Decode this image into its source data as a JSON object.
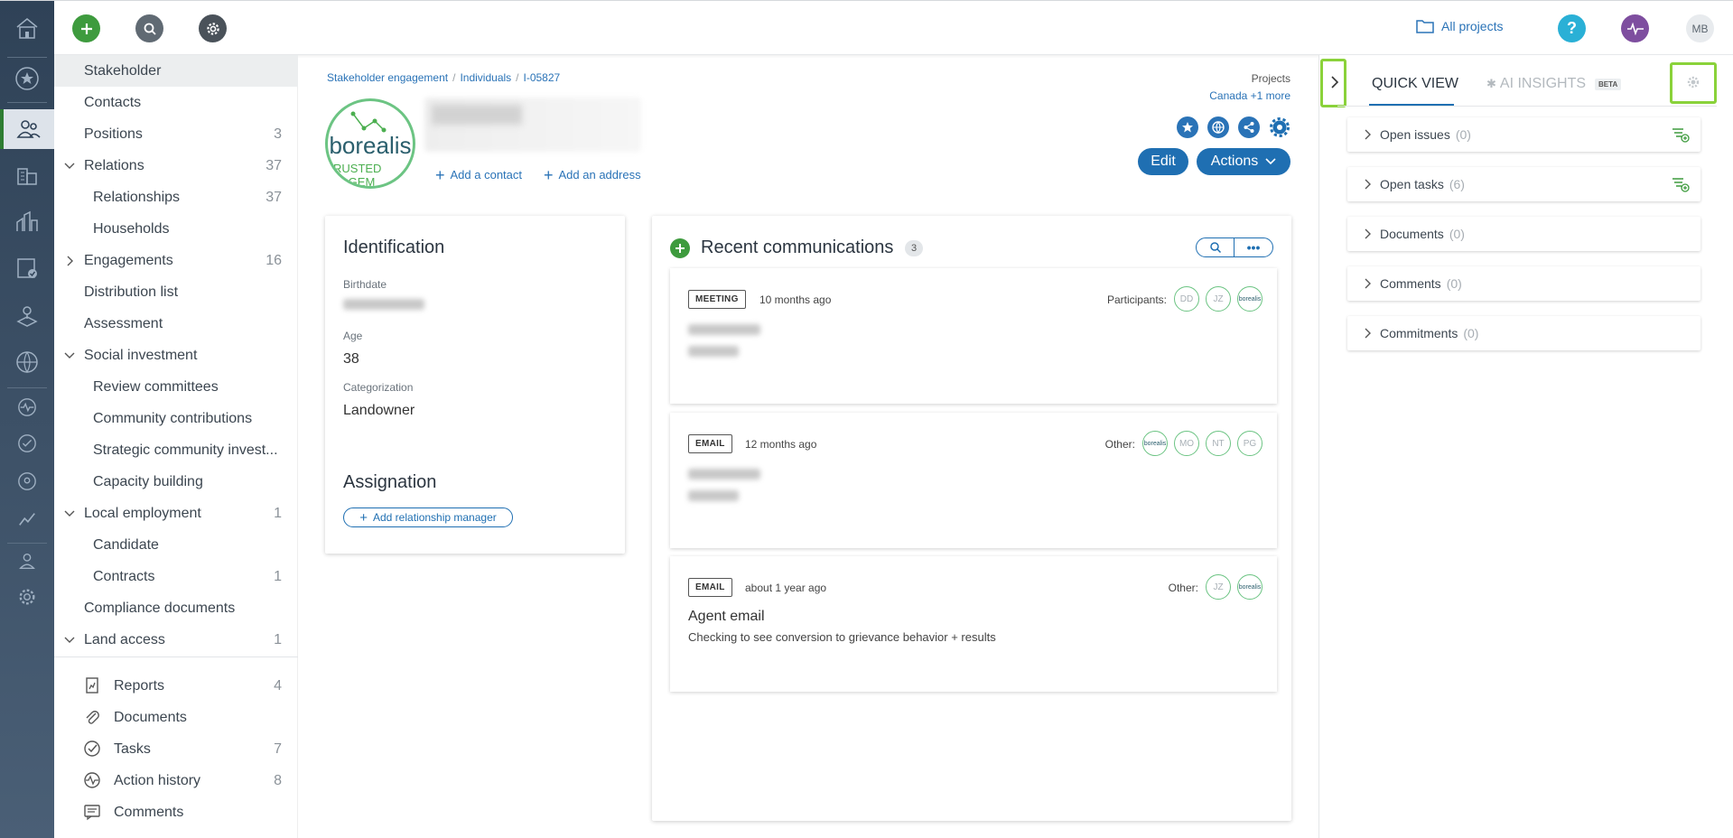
{
  "topbar": {
    "all_projects": "All projects",
    "user_initials": "MB"
  },
  "nav": {
    "items": [
      {
        "label": "Stakeholder",
        "count": "",
        "selected": true
      },
      {
        "label": "Contacts",
        "count": ""
      },
      {
        "label": "Positions",
        "count": "3"
      },
      {
        "label": "Relations",
        "count": "37",
        "chevron": "down"
      },
      {
        "label": "Relationships",
        "count": "37",
        "sub": true
      },
      {
        "label": "Households",
        "count": "",
        "sub": true
      },
      {
        "label": "Engagements",
        "count": "16",
        "chevron": "right"
      },
      {
        "label": "Distribution list",
        "count": ""
      },
      {
        "label": "Assessment",
        "count": ""
      },
      {
        "label": "Social investment",
        "count": "",
        "chevron": "down"
      },
      {
        "label": "Review committees",
        "count": "",
        "sub": true
      },
      {
        "label": "Community contributions",
        "count": "",
        "sub": true
      },
      {
        "label": "Strategic community invest...",
        "count": "",
        "sub": true
      },
      {
        "label": "Capacity building",
        "count": "",
        "sub": true
      },
      {
        "label": "Local employment",
        "count": "1",
        "chevron": "down"
      },
      {
        "label": "Candidate",
        "count": "",
        "sub": true
      },
      {
        "label": "Contracts",
        "count": "1",
        "sub": true
      },
      {
        "label": "Compliance documents",
        "count": ""
      },
      {
        "label": "Land access",
        "count": "1",
        "chevron": "down"
      }
    ],
    "bottom": [
      {
        "label": "Reports",
        "count": "4",
        "icon": "report-icon"
      },
      {
        "label": "Documents",
        "count": "",
        "icon": "paperclip-icon"
      },
      {
        "label": "Tasks",
        "count": "7",
        "icon": "check-circle-icon"
      },
      {
        "label": "Action history",
        "count": "8",
        "icon": "activity-icon"
      },
      {
        "label": "Comments",
        "count": "",
        "icon": "comment-icon"
      }
    ]
  },
  "breadcrumb": {
    "items": [
      "Stakeholder engagement",
      "Individuals",
      "I-05827"
    ]
  },
  "projects": {
    "title": "Projects",
    "value": "Canada",
    "more": "+1 more"
  },
  "profile": {
    "logo_text": "borealis",
    "logo_tagline_1": "RUSTED",
    "logo_tagline_2": "AGEM",
    "add_contact": "Add a contact",
    "add_address": "Add an address",
    "edit": "Edit",
    "actions": "Actions"
  },
  "identification": {
    "title": "Identification",
    "birthdate_label": "Birthdate",
    "age_label": "Age",
    "age": "38",
    "categorization_label": "Categorization",
    "categorization": "Landowner",
    "assignation_title": "Assignation",
    "add_manager": "Add relationship manager"
  },
  "communications": {
    "title": "Recent communications",
    "count": "3",
    "items": [
      {
        "type": "MEETING",
        "ago": "10 months ago",
        "people_label": "Participants:",
        "avatars": [
          "DD",
          "JZ",
          "borealis"
        ]
      },
      {
        "type": "EMAIL",
        "ago": "12 months ago",
        "people_label": "Other:",
        "avatars": [
          "borealis",
          "MO",
          "NT",
          "PG"
        ]
      },
      {
        "type": "EMAIL",
        "ago": "about 1 year ago",
        "people_label": "Other:",
        "avatars": [
          "JZ",
          "borealis"
        ],
        "subject": "Agent email",
        "body": "Checking to see conversion to grievance behavior + results"
      }
    ]
  },
  "right_panel": {
    "tab_quick_view": "QUICK VIEW",
    "tab_ai": "AI INSIGHTS",
    "beta": "BETA",
    "sections": [
      {
        "label": "Open issues",
        "count": "(0)"
      },
      {
        "label": "Open tasks",
        "count": "(6)"
      },
      {
        "label": "Documents",
        "count": "(0)"
      },
      {
        "label": "Comments",
        "count": "(0)"
      },
      {
        "label": "Commitments",
        "count": "(0)"
      }
    ]
  },
  "colors": {
    "accent": "#1f6fb2",
    "green": "#3e9b3e",
    "highlight": "#8ad23a",
    "rail": "#3a4e64"
  }
}
